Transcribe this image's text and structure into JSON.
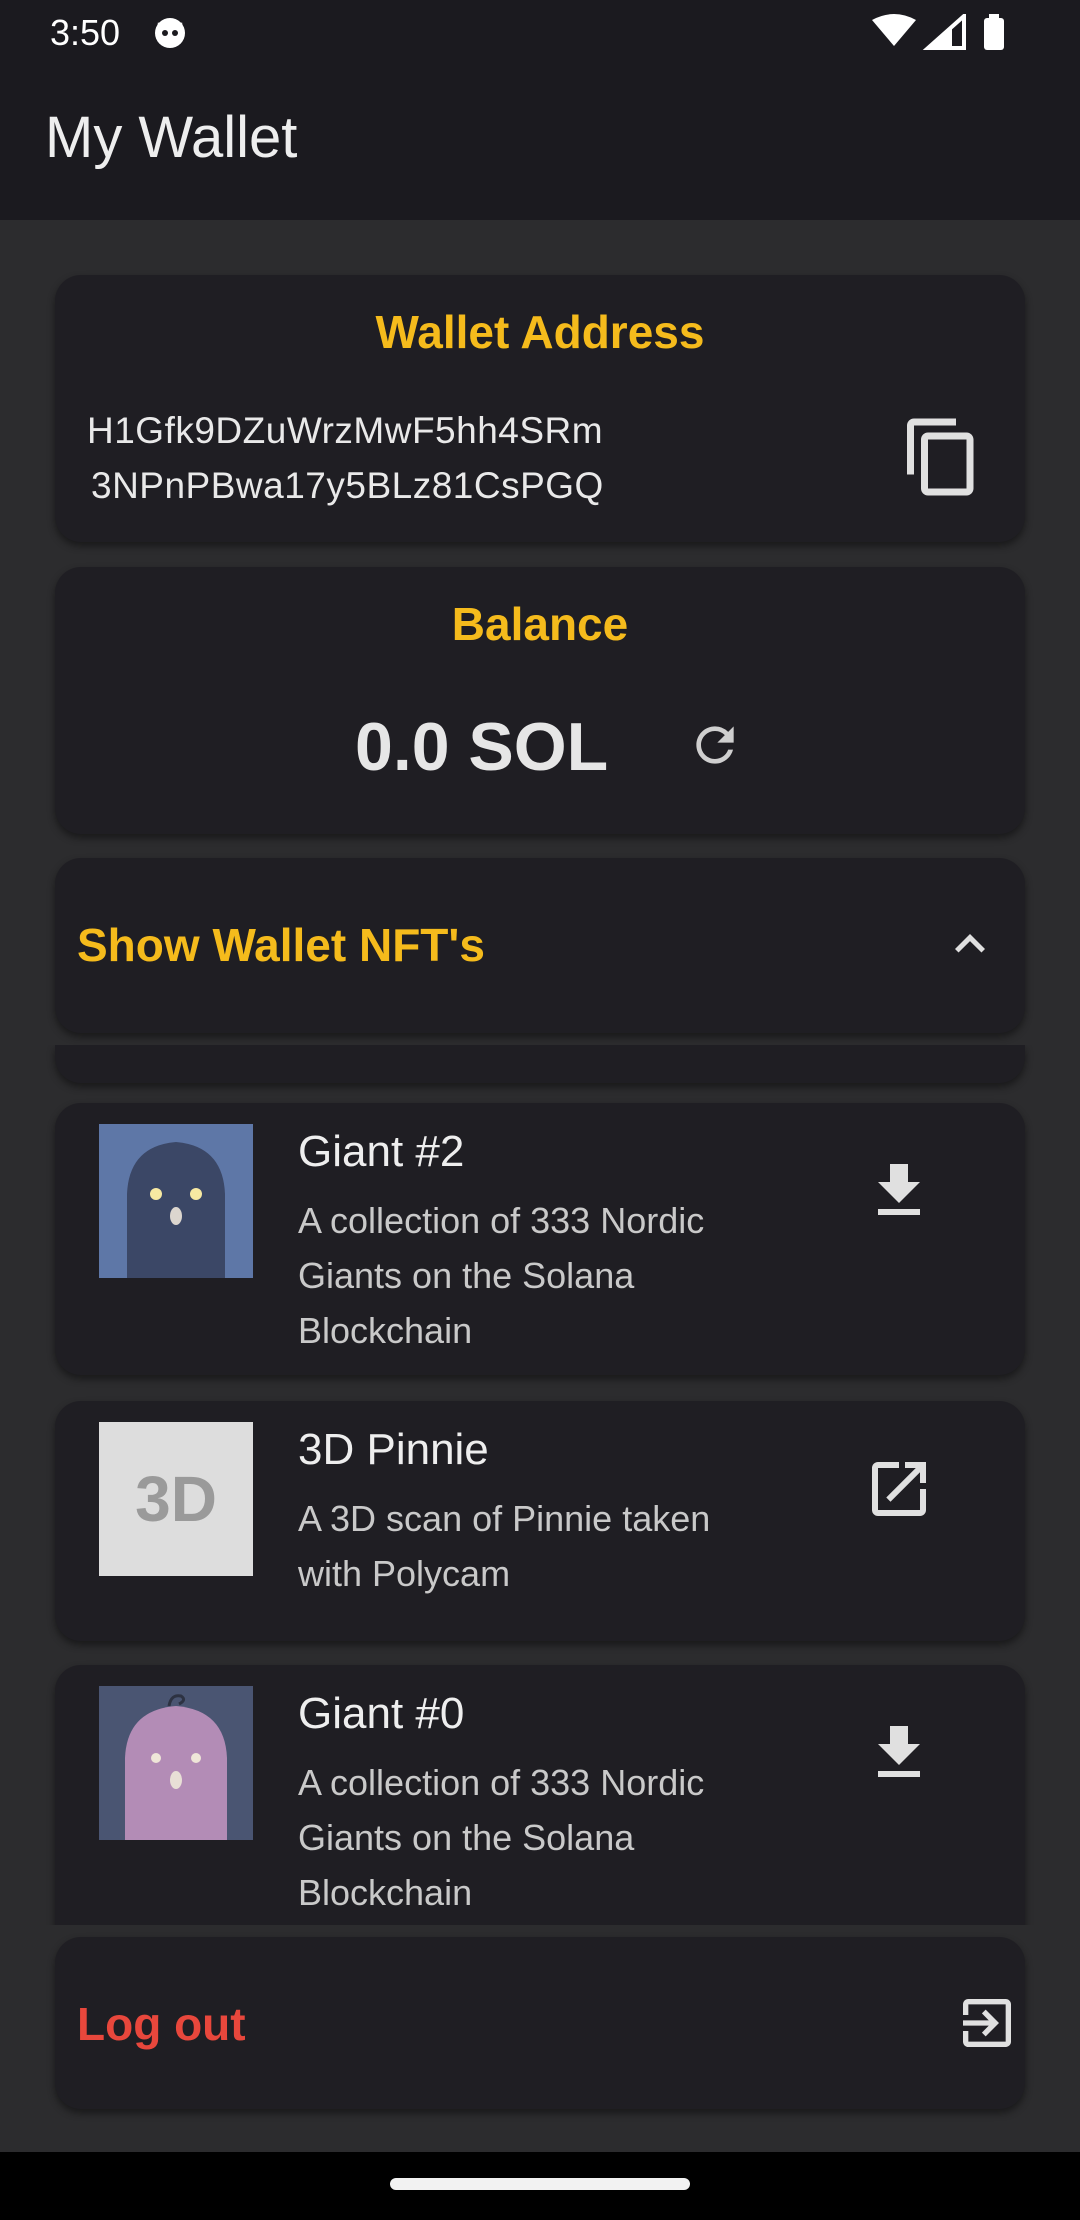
{
  "status_bar": {
    "time": "3:50"
  },
  "app_bar": {
    "title": "My Wallet"
  },
  "wallet_address": {
    "title": "Wallet Address",
    "line1": "H1Gfk9DZuWrzMwF5hh4SRm",
    "line2": "3NPnPBwa17y5BLz81CsPGQ"
  },
  "balance": {
    "title": "Balance",
    "value": "0.0 SOL"
  },
  "nft_section": {
    "label": "Show Wallet NFT's"
  },
  "nfts": [
    {
      "name": "Giant #2",
      "description": "A collection of 333 Nordic Giants on the Solana Blockchain",
      "action_icon": "download-icon"
    },
    {
      "name": "3D Pinnie",
      "thumb_text": "3D",
      "description": "A 3D scan of Pinnie taken with Polycam",
      "action_icon": "open-in-new-icon"
    },
    {
      "name": "Giant #0",
      "description": "A collection of 333 Nordic Giants on the Solana Blockchain",
      "action_icon": "download-icon"
    }
  ],
  "logout": {
    "label": "Log out"
  },
  "colors": {
    "accent": "#f5bb1c",
    "danger": "#e8473c",
    "card": "#1f1e23",
    "background": "#2c2c2e",
    "bar": "#1b1a1f"
  }
}
